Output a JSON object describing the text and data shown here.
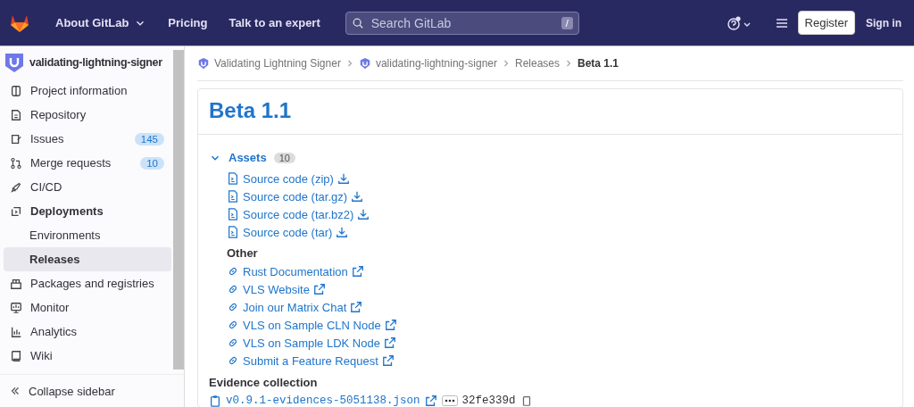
{
  "topbar": {
    "nav": [
      {
        "label": "About GitLab",
        "dropdown": true
      },
      {
        "label": "Pricing",
        "dropdown": false
      },
      {
        "label": "Talk to an expert",
        "dropdown": false
      }
    ],
    "search": {
      "placeholder": "Search GitLab",
      "shortcut": "/"
    },
    "register": "Register",
    "sign_in": "Sign in"
  },
  "sidebar": {
    "project": "validating-lightning-signer",
    "items": [
      {
        "label": "Project information",
        "selected": false
      },
      {
        "label": "Repository",
        "selected": false
      },
      {
        "label": "Issues",
        "count": "145",
        "selected": false
      },
      {
        "label": "Merge requests",
        "count": "10",
        "selected": false
      },
      {
        "label": "CI/CD",
        "selected": false
      },
      {
        "label": "Deployments",
        "selected": false,
        "children": [
          {
            "label": "Environments",
            "selected": false
          },
          {
            "label": "Releases",
            "selected": true
          }
        ]
      },
      {
        "label": "Packages and registries",
        "selected": false
      },
      {
        "label": "Monitor",
        "selected": false
      },
      {
        "label": "Analytics",
        "selected": false
      },
      {
        "label": "Wiki",
        "selected": false
      }
    ],
    "collapse": "Collapse sidebar"
  },
  "breadcrumb": [
    {
      "label": "Validating Lightning Signer",
      "avatar": true
    },
    {
      "label": "validating-lightning-signer",
      "avatar": true
    },
    {
      "label": "Releases",
      "avatar": false
    },
    {
      "label": "Beta 1.1",
      "avatar": false
    }
  ],
  "release": {
    "title": "Beta 1.1",
    "assets": {
      "label": "Assets",
      "count": "10",
      "expanded": true,
      "sources": [
        "Source code (zip)",
        "Source code (tar.gz)",
        "Source code (tar.bz2)",
        "Source code (tar)"
      ],
      "other_heading": "Other",
      "links": [
        "Rust Documentation",
        "VLS Website",
        "Join our Matrix Chat",
        "VLS on Sample CLN Node",
        "VLS on Sample LDK Node",
        "Submit a Feature Request"
      ]
    },
    "evidence": {
      "heading": "Evidence collection",
      "file": "v0.9.1-evidences-5051138.json",
      "sha": "32fe339d"
    }
  }
}
